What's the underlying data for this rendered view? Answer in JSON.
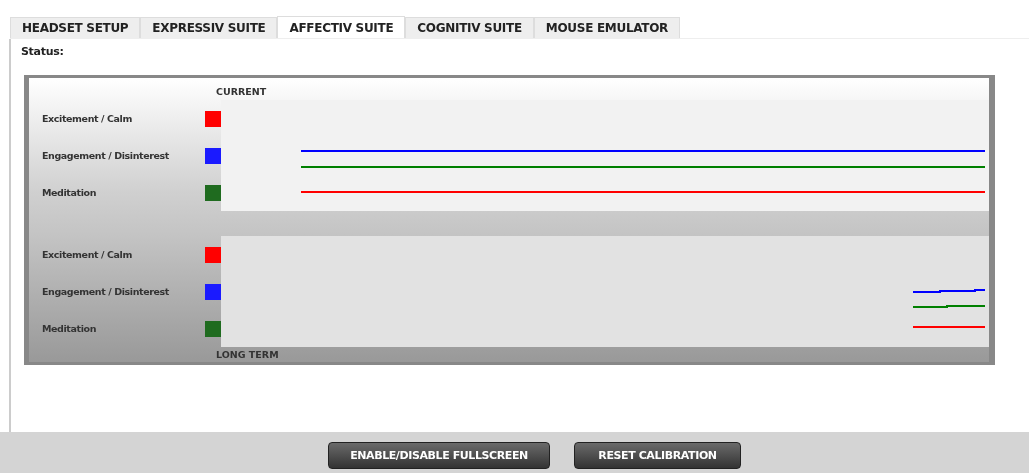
{
  "tabs": [
    {
      "label": "HEADSET SETUP",
      "selected": false
    },
    {
      "label": "EXPRESSIV SUITE",
      "selected": false
    },
    {
      "label": "AFFECTIV SUITE",
      "selected": true
    },
    {
      "label": "COGNITIV SUITE",
      "selected": false
    },
    {
      "label": "MOUSE EMULATOR",
      "selected": false
    }
  ],
  "status_label": "Status:",
  "panels": [
    {
      "kind": "current",
      "title": "CURRENT",
      "legend": [
        {
          "label": "Excitement / Calm",
          "color": "#ff0000"
        },
        {
          "label": "Engagement / Disinterest",
          "color": "#1a1aff"
        },
        {
          "label": "Meditation",
          "color": "#1f6b1f"
        }
      ]
    },
    {
      "kind": "long_term",
      "title": "LONG TERM",
      "legend": [
        {
          "label": "Excitement / Calm",
          "color": "#ff0000"
        },
        {
          "label": "Engagement / Disinterest",
          "color": "#1a1aff"
        },
        {
          "label": "Meditation",
          "color": "#1f6b1f"
        }
      ]
    }
  ],
  "buttons": [
    "ENABLE/DISABLE FULLSCREEN",
    "RESET CALIBRATION"
  ]
}
